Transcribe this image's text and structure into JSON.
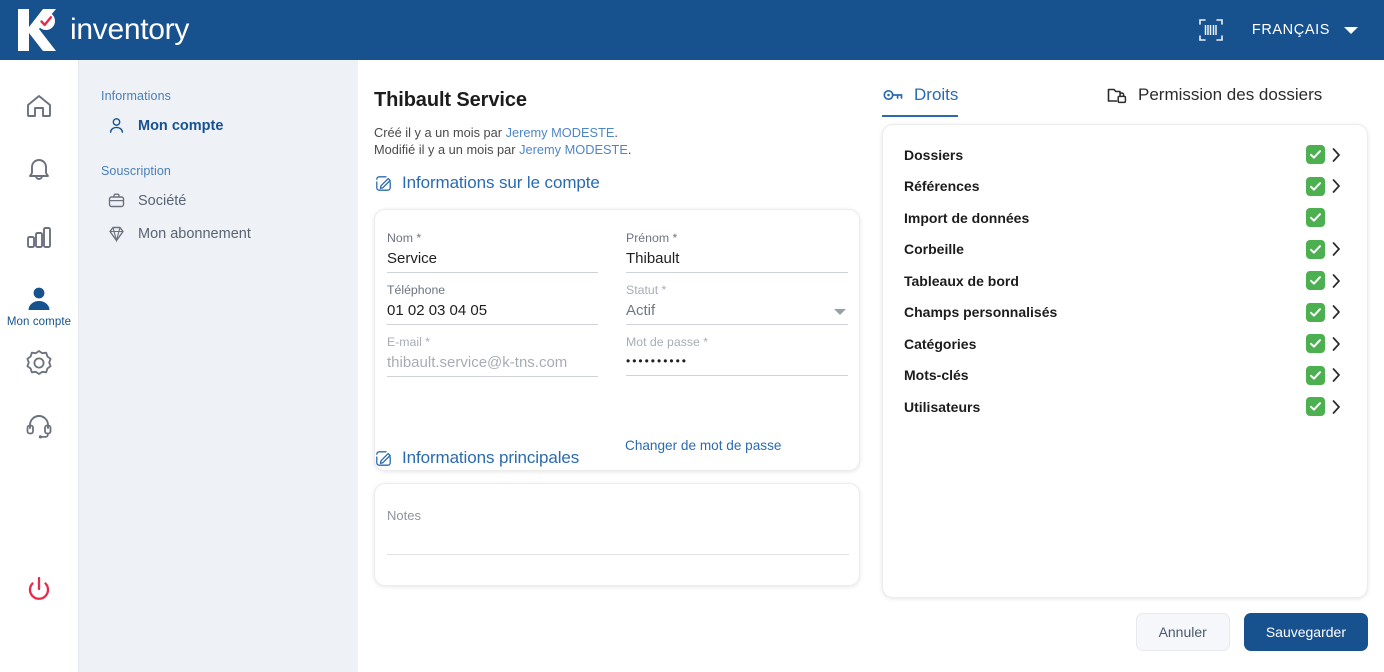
{
  "topbar": {
    "brand_word": "inventory",
    "logo_icon": "k-check-logo",
    "scan_icon": "barcode-scan-icon",
    "language": "FRANÇAIS",
    "caret_icon": "chevron-down-icon"
  },
  "rail": {
    "items": [
      {
        "icon": "home-icon",
        "label": "",
        "active": false
      },
      {
        "icon": "bell-icon",
        "label": "",
        "active": false
      },
      {
        "icon": "bar-chart-icon",
        "label": "",
        "active": false
      },
      {
        "icon": "user-icon",
        "label": "Mon compte",
        "active": true
      },
      {
        "icon": "gear-icon",
        "label": "",
        "active": false
      },
      {
        "icon": "headset-icon",
        "label": "",
        "active": false
      },
      {
        "icon": "power-icon",
        "label": "",
        "active": false
      }
    ]
  },
  "sidebar": {
    "groups": [
      {
        "title": "Informations",
        "items": [
          {
            "label": "Mon compte",
            "icon": "person-outline-icon",
            "active": true
          }
        ]
      },
      {
        "title": "Souscription",
        "items": [
          {
            "label": "Société",
            "icon": "briefcase-icon",
            "active": false
          },
          {
            "label": "Mon abonnement",
            "icon": "diamond-icon",
            "active": false
          }
        ]
      }
    ]
  },
  "main": {
    "page_title": "Thibault Service",
    "meta": {
      "created_prefix": "Créé il y a un mois par ",
      "created_author": "Jeremy MODESTE",
      "created_suffix": ".",
      "modified_prefix": "Modifié il y a un mois par ",
      "modified_author": "Jeremy MODESTE",
      "modified_suffix": "."
    },
    "section_account": {
      "title": "Informations sur le compte",
      "icon": "edit-square-icon"
    },
    "section_main": {
      "title": "Informations principales",
      "icon": "edit-square-icon"
    },
    "fields": {
      "nom": {
        "label": "Nom *",
        "value": "Service"
      },
      "prenom": {
        "label": "Prénom *",
        "value": "Thibault"
      },
      "telephone": {
        "label": "Téléphone",
        "value": "01 02 03 04 05"
      },
      "statut": {
        "label": "Statut *",
        "value": "Actif",
        "caret_icon": "chevron-down-icon"
      },
      "email": {
        "label": "E-mail *",
        "value": "thibault.service@k-tns.com"
      },
      "password": {
        "label": "Mot de passe *",
        "value": "••••••••••"
      }
    },
    "change_password_link": "Changer de mot de passe",
    "notes": {
      "placeholder": "Notes",
      "value": ""
    }
  },
  "rights_panel": {
    "tabs": [
      {
        "label": "Droits",
        "icon": "key-icon",
        "active": true
      },
      {
        "label": "Permission des dossiers",
        "icon": "folder-lock-icon",
        "active": false
      }
    ],
    "checkbox_color": "#4cb050",
    "rows": [
      {
        "label": "Dossiers",
        "checked": true,
        "has_chevron": true
      },
      {
        "label": "Références",
        "checked": true,
        "has_chevron": true
      },
      {
        "label": "Import de données",
        "checked": true,
        "has_chevron": false
      },
      {
        "label": "Corbeille",
        "checked": true,
        "has_chevron": true
      },
      {
        "label": "Tableaux de bord",
        "checked": true,
        "has_chevron": true
      },
      {
        "label": "Champs personnalisés",
        "checked": true,
        "has_chevron": true
      },
      {
        "label": "Catégories",
        "checked": true,
        "has_chevron": true
      },
      {
        "label": "Mots-clés",
        "checked": true,
        "has_chevron": true
      },
      {
        "label": "Utilisateurs",
        "checked": true,
        "has_chevron": true
      }
    ]
  },
  "footer": {
    "cancel_label": "Annuler",
    "save_label": "Sauvegarder"
  },
  "colors": {
    "header_blue": "#17528f",
    "accent_blue": "#2a6bb0",
    "sidebar_bg": "#eef1f6",
    "success_green": "#4cb050",
    "power_red": "#e8294a"
  }
}
